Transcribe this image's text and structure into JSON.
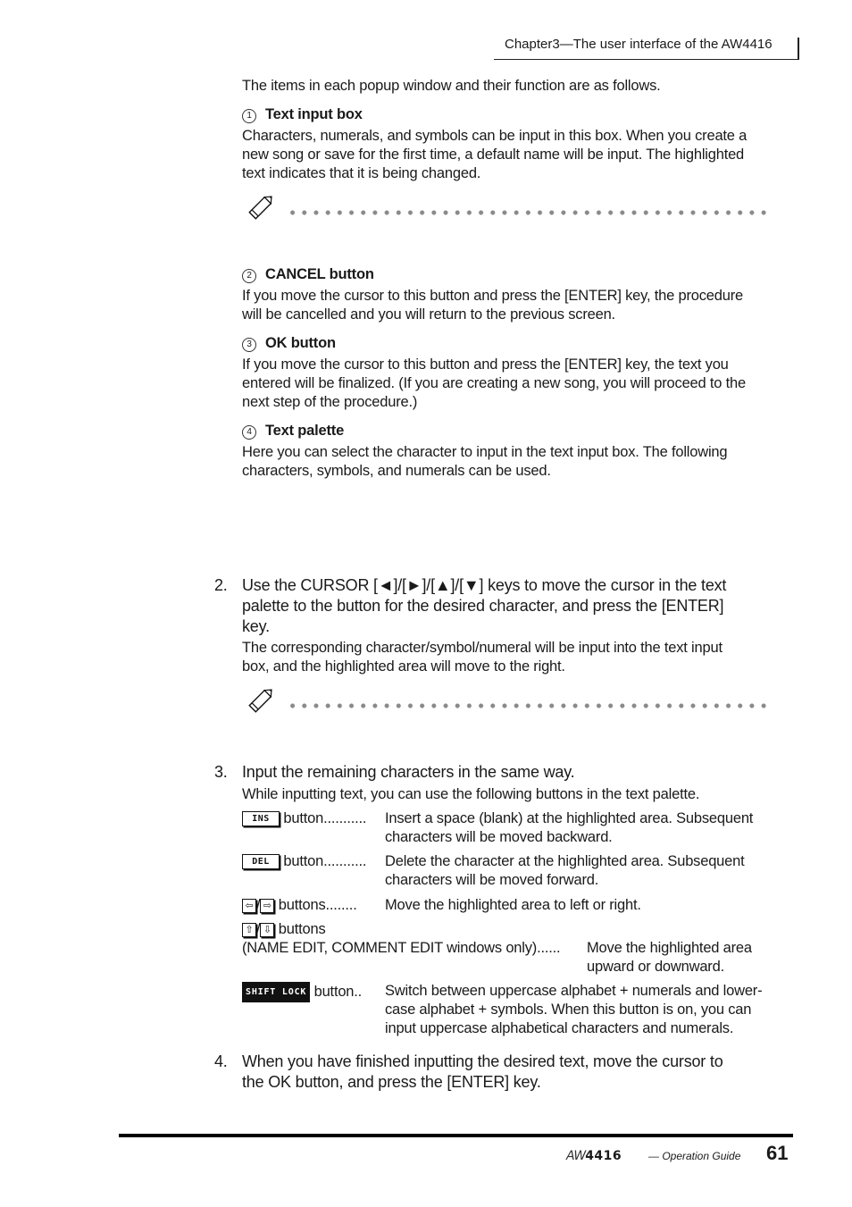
{
  "header": {
    "chapter_title": "Chapter3—The user interface of the AW4416"
  },
  "intro": "The items in each popup window and their function are as follows.",
  "items": [
    {
      "number": "1",
      "title": "Text input box",
      "lines": [
        "Characters, numerals, and symbols can be input in this box. When you create a",
        "new song or save for the first time, a default name will be input. The highlighted",
        "text indicates that it is being changed."
      ]
    },
    {
      "number": "2",
      "title": "CANCEL button",
      "lines": [
        "If you move the cursor to this button and press the [ENTER] key, the procedure",
        "will be cancelled and you will return to the previous screen."
      ]
    },
    {
      "number": "3",
      "title": "OK button",
      "lines": [
        "If you move the cursor to this button and press the [ENTER] key, the text you",
        "entered will be finalized. (If you are creating a new song, you will proceed to the",
        "next step of the procedure.)"
      ]
    },
    {
      "number": "4",
      "title": "Text palette",
      "lines": [
        "Here you can select the character to input in the text input box. The following",
        "characters, symbols, and numerals can be used."
      ]
    }
  ],
  "steps": [
    {
      "number": "2.",
      "lines": [
        "Use the CURSOR [◄]/[►]/[▲]/[▼] keys to move the cursor in the text",
        "palette to the button for the desired character, and press the [ENTER]",
        "key."
      ],
      "detail": [
        "The corresponding character/symbol/numeral will be input into the text input",
        "box, and the highlighted area will move to the right."
      ]
    },
    {
      "number": "3.",
      "lines": [
        "Input the remaining characters in the same way."
      ],
      "detail": [
        "While inputting text, you can use the following buttons in the text palette."
      ]
    },
    {
      "number": "4.",
      "lines": [
        "When you have finished inputting the desired text, move the cursor to",
        "the OK button, and press the [ENTER] key."
      ]
    }
  ],
  "buttons_list": [
    {
      "key_label": "INS",
      "term": "button...........",
      "desc": [
        "Insert a space (blank) at the highlighted area. Subsequent",
        "characters will be moved backward."
      ]
    },
    {
      "key_label": "DEL",
      "term": "button...........",
      "desc": [
        "Delete the character at the highlighted area. Subsequent",
        "characters will be moved forward."
      ]
    },
    {
      "key_icons": [
        "⇦",
        "⇨"
      ],
      "separator": "/",
      "term": "buttons........",
      "desc": [
        "Move the highlighted area to left or right."
      ]
    },
    {
      "key_icons": [
        "⇧",
        "⇩"
      ],
      "separator": "/",
      "term": "buttons",
      "subterm": "(NAME EDIT, COMMENT EDIT windows only)......",
      "desc": [
        "Move the highlighted area",
        "upward or downward."
      ]
    },
    {
      "key_label": "SHIFT LOCK",
      "term": "button..",
      "desc": [
        "Switch between uppercase alphabet + numerals and lower-",
        "case alphabet + symbols. When this button is on, you can",
        "input uppercase alphabetical characters and numerals."
      ]
    }
  ],
  "footer": {
    "logo_prefix": "AW",
    "logo_model": "4416",
    "guide": "— Operation Guide",
    "page_number": "61"
  }
}
